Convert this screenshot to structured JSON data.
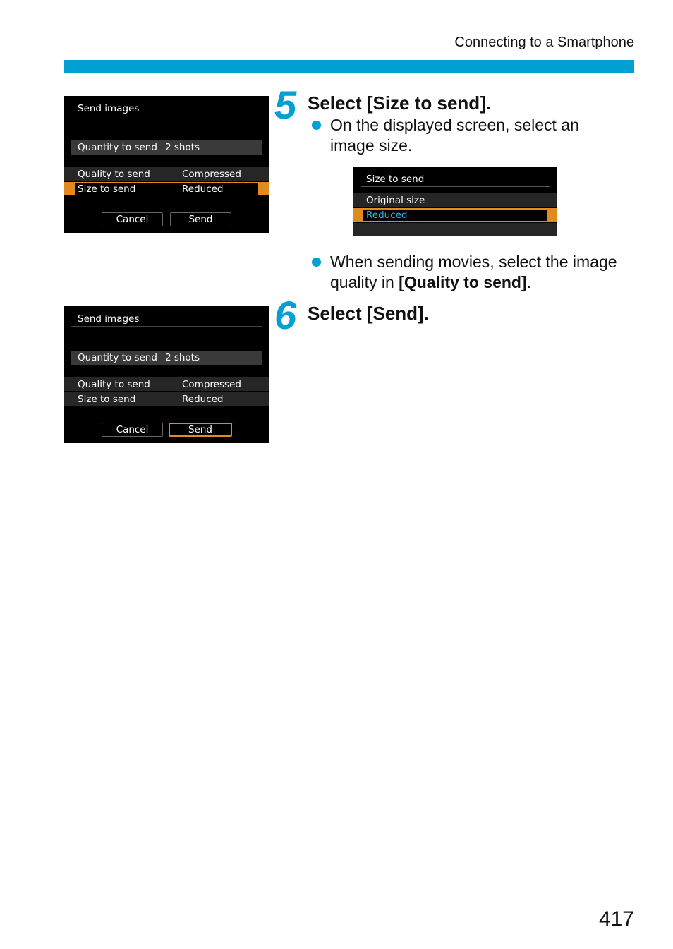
{
  "page": {
    "section_title": "Connecting to a Smartphone",
    "page_number": "417",
    "accent_color": "#00a0d2"
  },
  "screen_a": {
    "title": "Send images",
    "quantity_label": "Quantity to send",
    "quantity_value": "2 shots",
    "rows": [
      {
        "label": "Quality to send",
        "value": "Compressed",
        "selected": false
      },
      {
        "label": "Size to send",
        "value": "Reduced",
        "selected": true
      }
    ],
    "cancel_label": "Cancel",
    "send_label": "Send",
    "focused_button": "none"
  },
  "screen_b": {
    "title": "Send images",
    "quantity_label": "Quantity to send",
    "quantity_value": "2 shots",
    "rows": [
      {
        "label": "Quality to send",
        "value": "Compressed",
        "selected": false
      },
      {
        "label": "Size to send",
        "value": "Reduced",
        "selected": false
      }
    ],
    "cancel_label": "Cancel",
    "send_label": "Send",
    "focused_button": "send"
  },
  "size_screen": {
    "title": "Size to send",
    "options": [
      "Original size",
      "Reduced"
    ],
    "selected": "Reduced"
  },
  "steps": [
    {
      "number": "5",
      "title": "Select [Size to send].",
      "bullets": [
        {
          "text": "On the displayed screen, select an image size."
        },
        {
          "prefix": "When sending movies, select the image quality in ",
          "bold": "[Quality to send]",
          "suffix": "."
        }
      ]
    },
    {
      "number": "6",
      "title": "Select [Send]."
    }
  ]
}
